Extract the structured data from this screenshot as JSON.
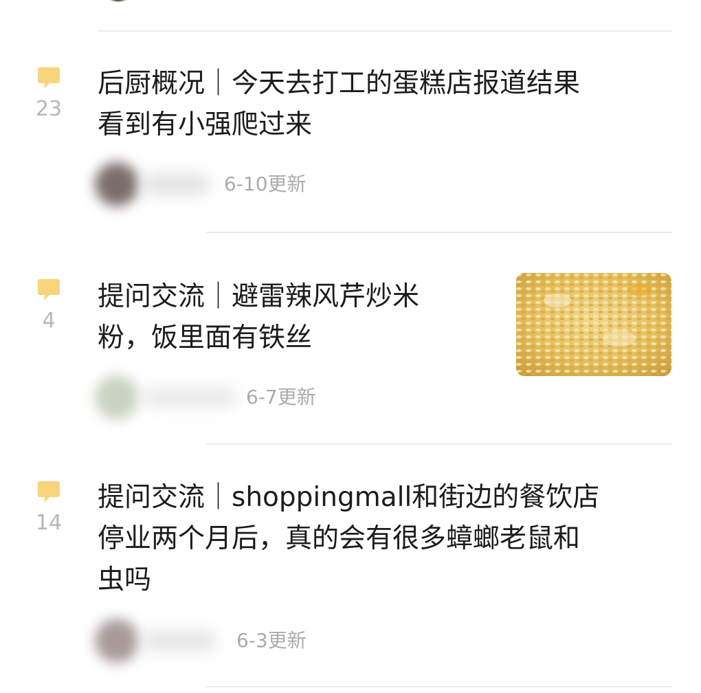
{
  "colors": {
    "accent_bubble": "#F8D47C",
    "count_text": "#B7B7B7",
    "title_text": "#1C1C1C",
    "date_text": "#ABABAB",
    "divider": "#ECECEC"
  },
  "posts": [
    {
      "comment_count": "23",
      "title_line1": "后厨概况｜今天去打工的蛋糕店报道结果",
      "title_line2": "看到有小强爬过来",
      "updated": "6-10更新",
      "has_thumbnail": false
    },
    {
      "comment_count": "4",
      "title_line1": "提问交流｜避雷辣风芹炒米",
      "title_line2": "粉，饭里面有铁丝",
      "updated": "6-7更新",
      "has_thumbnail": true,
      "thumbnail_icon": "fried-rice-photo"
    },
    {
      "comment_count": "14",
      "title_line1": "提问交流｜shoppingmall和街边的餐饮店",
      "title_line2": "停业两个月后，真的会有很多蟑螂老鼠和",
      "title_line3": "虫吗",
      "updated": "6-3更新",
      "has_thumbnail": false
    }
  ]
}
